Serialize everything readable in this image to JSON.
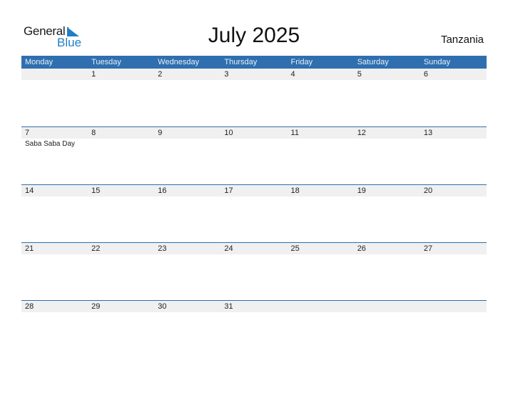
{
  "logo": {
    "line1": "General",
    "line2": "Blue",
    "brand_color": "#1f7fc4"
  },
  "title": "July 2025",
  "country": "Tanzania",
  "colors": {
    "header": "#2f6fb0",
    "date_band": "#f0f0f0"
  },
  "weekdays": [
    "Monday",
    "Tuesday",
    "Wednesday",
    "Thursday",
    "Friday",
    "Saturday",
    "Sunday"
  ],
  "weeks": [
    {
      "days": [
        {
          "date": "",
          "event": ""
        },
        {
          "date": "1",
          "event": ""
        },
        {
          "date": "2",
          "event": ""
        },
        {
          "date": "3",
          "event": ""
        },
        {
          "date": "4",
          "event": ""
        },
        {
          "date": "5",
          "event": ""
        },
        {
          "date": "6",
          "event": ""
        }
      ]
    },
    {
      "days": [
        {
          "date": "7",
          "event": "Saba Saba Day"
        },
        {
          "date": "8",
          "event": ""
        },
        {
          "date": "9",
          "event": ""
        },
        {
          "date": "10",
          "event": ""
        },
        {
          "date": "11",
          "event": ""
        },
        {
          "date": "12",
          "event": ""
        },
        {
          "date": "13",
          "event": ""
        }
      ]
    },
    {
      "days": [
        {
          "date": "14",
          "event": ""
        },
        {
          "date": "15",
          "event": ""
        },
        {
          "date": "16",
          "event": ""
        },
        {
          "date": "17",
          "event": ""
        },
        {
          "date": "18",
          "event": ""
        },
        {
          "date": "19",
          "event": ""
        },
        {
          "date": "20",
          "event": ""
        }
      ]
    },
    {
      "days": [
        {
          "date": "21",
          "event": ""
        },
        {
          "date": "22",
          "event": ""
        },
        {
          "date": "23",
          "event": ""
        },
        {
          "date": "24",
          "event": ""
        },
        {
          "date": "25",
          "event": ""
        },
        {
          "date": "26",
          "event": ""
        },
        {
          "date": "27",
          "event": ""
        }
      ]
    },
    {
      "days": [
        {
          "date": "28",
          "event": ""
        },
        {
          "date": "29",
          "event": ""
        },
        {
          "date": "30",
          "event": ""
        },
        {
          "date": "31",
          "event": ""
        },
        {
          "date": "",
          "event": ""
        },
        {
          "date": "",
          "event": ""
        },
        {
          "date": "",
          "event": ""
        }
      ]
    }
  ]
}
